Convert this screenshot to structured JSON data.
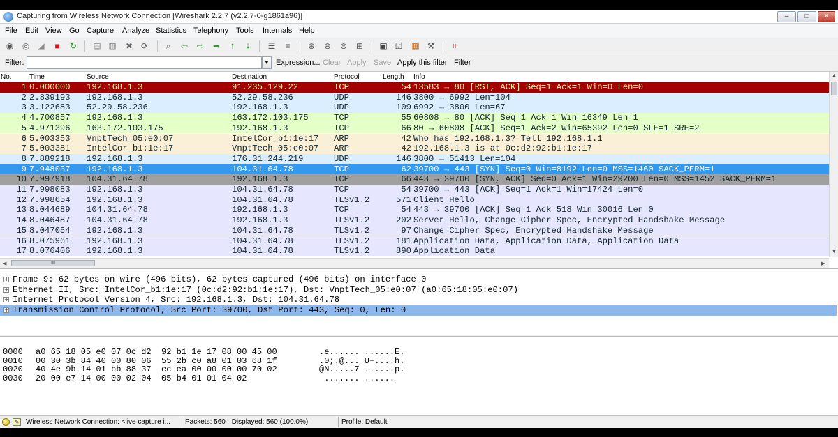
{
  "window": {
    "title": "Capturing from Wireless Network Connection [Wireshark 2.2.7 (v2.2.7-0-g1861a96)]",
    "controls": {
      "minimize": "–",
      "maximize": "□",
      "close": "✕"
    }
  },
  "menu": [
    "File",
    "Edit",
    "View",
    "Go",
    "Capture",
    "Analyze",
    "Statistics",
    "Telephony",
    "Tools",
    "Internals",
    "Help"
  ],
  "toolbar": {
    "icons": [
      {
        "name": "interfaces-icon",
        "glyph": "◉",
        "color": "#555555"
      },
      {
        "name": "options-icon",
        "glyph": "◎",
        "color": "#666666"
      },
      {
        "name": "start-capture-icon",
        "glyph": "◢",
        "color": "#888888"
      },
      {
        "name": "stop-capture-icon",
        "glyph": "■",
        "color": "#dd1111"
      },
      {
        "name": "restart-capture-icon",
        "glyph": "↻",
        "color": "#2a9a2a"
      },
      {
        "name": "open-file-icon",
        "glyph": "▤",
        "color": "#888888"
      },
      {
        "name": "save-file-icon",
        "glyph": "▥",
        "color": "#888888"
      },
      {
        "name": "close-file-icon",
        "glyph": "✖",
        "color": "#666666"
      },
      {
        "name": "reload-icon",
        "glyph": "⟳",
        "color": "#666666"
      },
      {
        "name": "find-packet-icon",
        "glyph": "⌕",
        "color": "#666666"
      },
      {
        "name": "go-back-icon",
        "glyph": "⇦",
        "color": "#2e9a2e"
      },
      {
        "name": "go-forward-icon",
        "glyph": "⇨",
        "color": "#2e9a2e"
      },
      {
        "name": "go-to-packet-icon",
        "glyph": "➥",
        "color": "#2e9a2e"
      },
      {
        "name": "first-packet-icon",
        "glyph": "⤒",
        "color": "#2e9a2e"
      },
      {
        "name": "last-packet-icon",
        "glyph": "⤓",
        "color": "#2e9a2e"
      },
      {
        "name": "colorize-icon",
        "glyph": "☰",
        "color": "#555555"
      },
      {
        "name": "auto-scroll-icon",
        "glyph": "≡",
        "color": "#555555"
      },
      {
        "name": "zoom-in-icon",
        "glyph": "⊕",
        "color": "#555555"
      },
      {
        "name": "zoom-out-icon",
        "glyph": "⊖",
        "color": "#555555"
      },
      {
        "name": "normal-size-icon",
        "glyph": "⊜",
        "color": "#555555"
      },
      {
        "name": "resize-columns-icon",
        "glyph": "⊞",
        "color": "#555555"
      },
      {
        "name": "capture-filters-icon",
        "glyph": "▣",
        "color": "#444444"
      },
      {
        "name": "display-filters-icon",
        "glyph": "☑",
        "color": "#444444"
      },
      {
        "name": "coloring-rules-icon",
        "glyph": "▦",
        "color": "#c06010"
      },
      {
        "name": "preferences-icon",
        "glyph": "⚒",
        "color": "#555555"
      },
      {
        "name": "help-icon",
        "glyph": "⌗",
        "color": "#cc2222"
      }
    ]
  },
  "filter": {
    "label": "Filter:",
    "value": "",
    "dropdown": "▼",
    "buttons": [
      {
        "label": "Expression...",
        "enabled": true
      },
      {
        "label": "Clear",
        "enabled": false
      },
      {
        "label": "Apply",
        "enabled": false
      },
      {
        "label": "Save",
        "enabled": false
      },
      {
        "label": "Apply this filter",
        "enabled": true
      },
      {
        "label": "Filter",
        "enabled": true
      }
    ]
  },
  "columns": [
    "No.",
    "Time",
    "Source",
    "Destination",
    "Protocol",
    "Length",
    "Info"
  ],
  "packets": [
    {
      "no": "1",
      "time": "0.000000",
      "src": "192.168.1.3",
      "dst": "91.235.129.22",
      "proto": "TCP",
      "len": "54",
      "info": "13583 → 80 [RST, ACK] Seq=1 Ack=1 Win=0 Len=0",
      "bg": "#a40000",
      "fg": "#fff7a0"
    },
    {
      "no": "2",
      "time": "2.839193",
      "src": "192.168.1.3",
      "dst": "52.29.58.236",
      "proto": "UDP",
      "len": "146",
      "info": "3800 → 6992 Len=104",
      "bg": "#daeeff",
      "fg": "#12272e"
    },
    {
      "no": "3",
      "time": "3.122683",
      "src": "52.29.58.236",
      "dst": "192.168.1.3",
      "proto": "UDP",
      "len": "109",
      "info": "6992 → 3800 Len=67",
      "bg": "#daeeff",
      "fg": "#12272e"
    },
    {
      "no": "4",
      "time": "4.700857",
      "src": "192.168.1.3",
      "dst": "163.172.103.175",
      "proto": "TCP",
      "len": "55",
      "info": "60808 → 80 [ACK] Seq=1 Ack=1 Win=16349 Len=1",
      "bg": "#e4ffc7",
      "fg": "#12272e"
    },
    {
      "no": "5",
      "time": "4.971396",
      "src": "163.172.103.175",
      "dst": "192.168.1.3",
      "proto": "TCP",
      "len": "66",
      "info": "80 → 60808 [ACK] Seq=1 Ack=2 Win=65392 Len=0 SLE=1 SRE=2",
      "bg": "#e4ffc7",
      "fg": "#12272e"
    },
    {
      "no": "6",
      "time": "5.003353",
      "src": "VnptTech_05:e0:07",
      "dst": "IntelCor_b1:1e:17",
      "proto": "ARP",
      "len": "42",
      "info": "Who has 192.168.1.3? Tell 192.168.1.1",
      "bg": "#faf0d7",
      "fg": "#12272e"
    },
    {
      "no": "7",
      "time": "5.003381",
      "src": "IntelCor_b1:1e:17",
      "dst": "VnptTech_05:e0:07",
      "proto": "ARP",
      "len": "42",
      "info": "192.168.1.3 is at 0c:d2:92:b1:1e:17",
      "bg": "#faf0d7",
      "fg": "#12272e"
    },
    {
      "no": "8",
      "time": "7.889218",
      "src": "192.168.1.3",
      "dst": "176.31.244.219",
      "proto": "UDP",
      "len": "146",
      "info": "3800 → 51413 Len=104",
      "bg": "#daeeff",
      "fg": "#12272e"
    },
    {
      "no": "9",
      "time": "7.948037",
      "src": "192.168.1.3",
      "dst": "104.31.64.78",
      "proto": "TCP",
      "len": "62",
      "info": "39700 → 443 [SYN] Seq=0 Win=8192 Len=0 MSS=1460 SACK_PERM=1",
      "bg": "#3399ee",
      "fg": "#ffffff"
    },
    {
      "no": "10",
      "time": "7.997918",
      "src": "104.31.64.78",
      "dst": "192.168.1.3",
      "proto": "TCP",
      "len": "66",
      "info": "443 → 39700 [SYN, ACK] Seq=0 Ack=1 Win=29200 Len=0 MSS=1452 SACK_PERM=1",
      "bg": "#a0a0a0",
      "fg": "#12272e"
    },
    {
      "no": "11",
      "time": "7.998083",
      "src": "192.168.1.3",
      "dst": "104.31.64.78",
      "proto": "TCP",
      "len": "54",
      "info": "39700 → 443 [ACK] Seq=1 Ack=1 Win=17424 Len=0",
      "bg": "#e7e6ff",
      "fg": "#12272e"
    },
    {
      "no": "12",
      "time": "7.998654",
      "src": "192.168.1.3",
      "dst": "104.31.64.78",
      "proto": "TLSv1.2",
      "len": "571",
      "info": "Client Hello",
      "bg": "#e7e6ff",
      "fg": "#12272e"
    },
    {
      "no": "13",
      "time": "8.044689",
      "src": "104.31.64.78",
      "dst": "192.168.1.3",
      "proto": "TCP",
      "len": "54",
      "info": "443 → 39700 [ACK] Seq=1 Ack=518 Win=30016 Len=0",
      "bg": "#e7e6ff",
      "fg": "#12272e"
    },
    {
      "no": "14",
      "time": "8.046487",
      "src": "104.31.64.78",
      "dst": "192.168.1.3",
      "proto": "TLSv1.2",
      "len": "202",
      "info": "Server Hello, Change Cipher Spec, Encrypted Handshake Message",
      "bg": "#e7e6ff",
      "fg": "#12272e"
    },
    {
      "no": "15",
      "time": "8.047054",
      "src": "192.168.1.3",
      "dst": "104.31.64.78",
      "proto": "TLSv1.2",
      "len": "97",
      "info": "Change Cipher Spec, Encrypted Handshake Message",
      "bg": "#e7e6ff",
      "fg": "#12272e"
    },
    {
      "no": "16",
      "time": "8.075961",
      "src": "192.168.1.3",
      "dst": "104.31.64.78",
      "proto": "TLSv1.2",
      "len": "181",
      "info": "Application Data, Application Data, Application Data",
      "bg": "#e7e6ff",
      "fg": "#12272e"
    },
    {
      "no": "17",
      "time": "8.076406",
      "src": "192.168.1.3",
      "dst": "104.31.64.78",
      "proto": "TLSv1.2",
      "len": "890",
      "info": "Application Data",
      "bg": "#e7e6ff",
      "fg": "#12272e"
    }
  ],
  "scrollbar": {
    "hthumb": "III",
    "up": "▲",
    "down": "▼",
    "left": "◀",
    "right": "▶"
  },
  "details": [
    {
      "expander": "+",
      "text": "Frame 9: 62 bytes on wire (496 bits), 62 bytes captured (496 bits) on interface 0",
      "selected": false
    },
    {
      "expander": "+",
      "text": "Ethernet II, Src: IntelCor_b1:1e:17 (0c:d2:92:b1:1e:17), Dst: VnptTech_05:e0:07 (a0:65:18:05:e0:07)",
      "selected": false
    },
    {
      "expander": "+",
      "text": "Internet Protocol Version 4, Src: 192.168.1.3, Dst: 104.31.64.78",
      "selected": false
    },
    {
      "expander": "+",
      "text": "Transmission Control Protocol, Src Port: 39700, Dst Port: 443, Seq: 0, Len: 0",
      "selected": true
    }
  ],
  "bytes": [
    {
      "offset": "0000",
      "hex": "a0 65 18 05 e0 07 0c d2  92 b1 1e 17 08 00 45 00",
      "ascii": ".e...... ......E."
    },
    {
      "offset": "0010",
      "hex": "00 30 3b 84 40 00 80 06  55 2b c0 a8 01 03 68 1f",
      "ascii": ".0;.@... U+....h."
    },
    {
      "offset": "0020",
      "hex": "40 4e 9b 14 01 bb 88 37  ec ea 00 00 00 00 70 02",
      "ascii": "@N.....7 ......p."
    },
    {
      "offset": "0030",
      "hex": "20 00 e7 14 00 00 02 04  05 b4 01 01 04 02",
      "ascii": " ....... ......"
    }
  ],
  "status": {
    "capture": "Wireless Network Connection: <live capture i...",
    "packets": "Packets: 560 · Displayed: 560 (100.0%)",
    "profile": "Profile: Default"
  },
  "colors": {
    "selected_detail": "#8cb8ee",
    "accent": "#3399ee"
  }
}
